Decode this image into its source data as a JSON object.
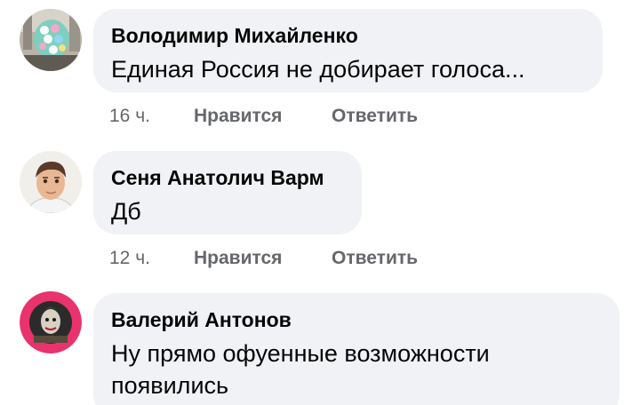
{
  "comments": [
    {
      "author": "Володимир Михайленко",
      "text": "Единая Россия не добирает голоса...",
      "time": "16 ч.",
      "like": "Нравится",
      "reply": "Ответить"
    },
    {
      "author": "Сеня Анатолич Варм",
      "text": "Дб",
      "time": "12 ч.",
      "like": "Нравится",
      "reply": "Ответить"
    },
    {
      "author": "Валерий Антонов",
      "text": "Ну прямо офуенные возможности появились"
    }
  ],
  "colors": {
    "bubble": "#f0f2f5",
    "name": "#050505",
    "meta": "#65676b",
    "avatar3_ring": "#e8336d"
  },
  "icons": [
    "avatar-balloons-icon",
    "avatar-cartoon-man-icon",
    "avatar-joker-icon"
  ]
}
